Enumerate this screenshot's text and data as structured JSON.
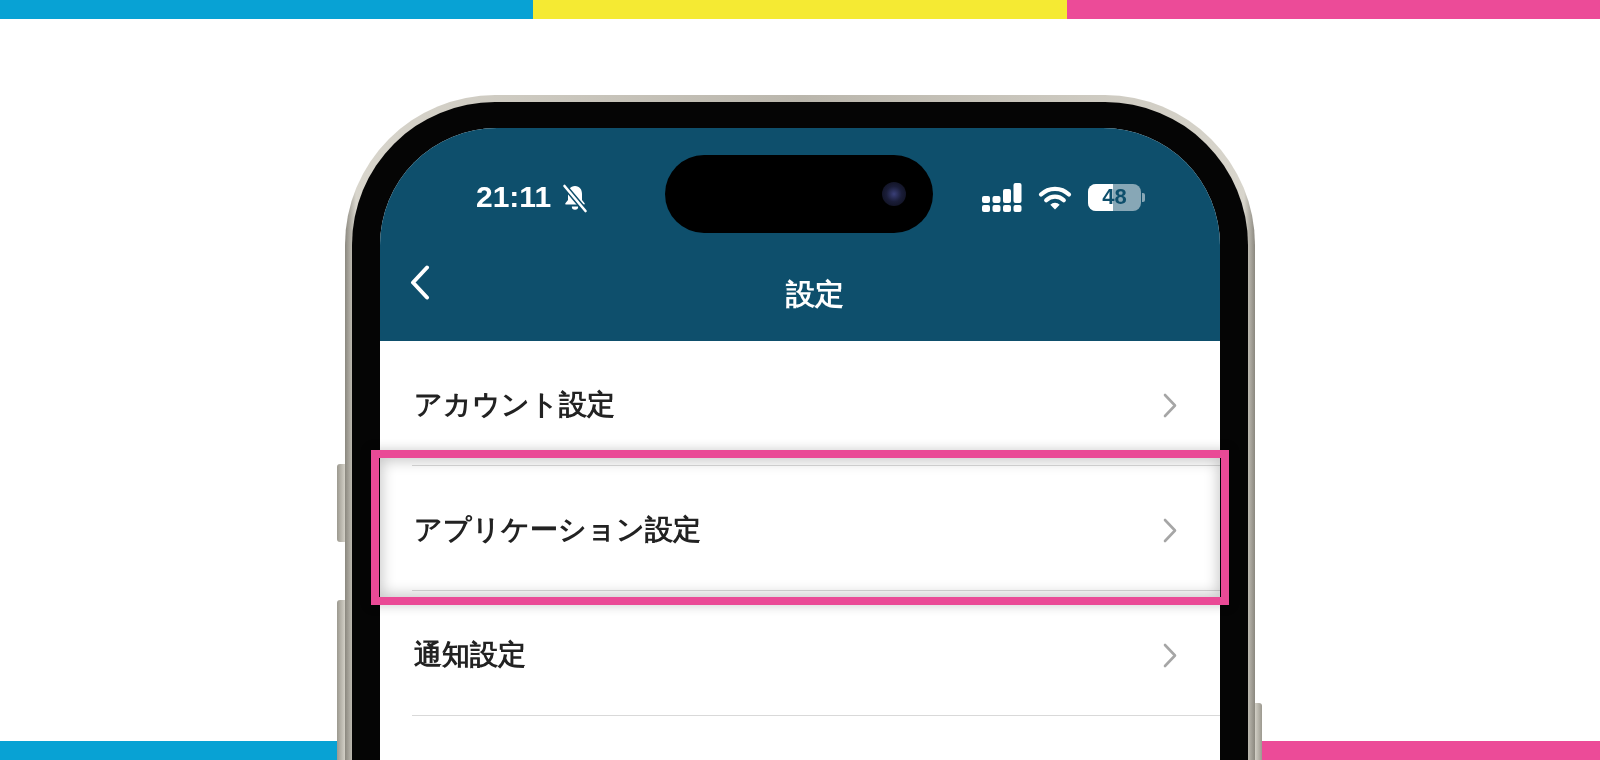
{
  "status_bar": {
    "time": "21:11",
    "silent": true,
    "battery": "48"
  },
  "nav_bar": {
    "title": "設定"
  },
  "settings_list": {
    "items": [
      {
        "label": "アカウント設定",
        "highlighted": false
      },
      {
        "label": "アプリケーション設定",
        "highlighted": true
      },
      {
        "label": "通知設定",
        "highlighted": false
      }
    ]
  }
}
